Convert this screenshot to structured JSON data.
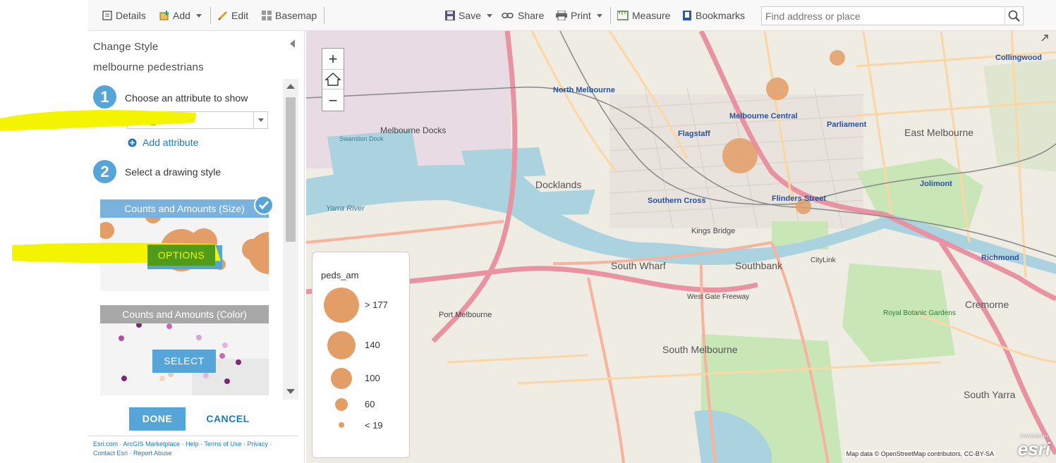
{
  "toolbar": {
    "details": "Details",
    "add": "Add",
    "edit": "Edit",
    "basemap": "Basemap",
    "save": "Save",
    "share": "Share",
    "print": "Print",
    "measure": "Measure",
    "bookmarks": "Bookmarks",
    "search_placeholder": "Find address or place"
  },
  "panel": {
    "title": "Change Style",
    "layer_name": "melbourne pedestrians",
    "step1_label": "Choose an attribute to show",
    "attribute_value": "peds_am",
    "add_attribute": "Add attribute",
    "step2_label": "Select a drawing style",
    "style_size_title": "Counts and Amounts (Size)",
    "options_button": "OPTIONS",
    "style_color_title": "Counts and Amounts (Color)",
    "select_button": "SELECT",
    "done_button": "DONE",
    "cancel_button": "CANCEL",
    "footer": {
      "esri": "Esri.com",
      "marketplace": "ArcGIS Marketplace",
      "help": "Help",
      "terms": "Terms of Use",
      "privacy": "Privacy",
      "contact": "Contact Esri",
      "report": "Report Abuse"
    }
  },
  "legend": {
    "title": "peds_am",
    "items": [
      {
        "label": "> 177"
      },
      {
        "label": "140"
      },
      {
        "label": "100"
      },
      {
        "label": "60"
      },
      {
        "label": "< 19"
      }
    ]
  },
  "map": {
    "attribution": "Map data © OpenStreetMap contributors, CC-BY-SA",
    "logo_small": "POWERED BY",
    "logo": "esri",
    "labels": {
      "docklands": "Docklands",
      "melbourne_docks": "Melbourne Docks",
      "north_melbourne": "North Melbourne",
      "melbourne_central": "Melbourne Central",
      "flagstaff": "Flagstaff",
      "parliament": "Parliament",
      "east_melbourne": "East Melbourne",
      "southbank": "Southbank",
      "south_wharf": "South Wharf",
      "south_melbourne": "South Melbourne",
      "port_melbourne": "Port Melbourne",
      "cremorne": "Cremorne",
      "south_yarra": "South Yarra",
      "jolimont": "Jolimont",
      "richmond": "Richmond",
      "collingwood": "Collingwood",
      "southern_cross": "Southern Cross",
      "flinders_street": "Flinders Street",
      "kings_bridge": "Kings Bridge",
      "swanston_dock": "Swanston Dock",
      "yarra_river": "Yarra River",
      "royal_botanic": "Royal Botanic Gardens",
      "west_gate_freeway": "West Gate Freeway",
      "citylink": "CityLink"
    }
  },
  "colors": {
    "accent": "#56a5d8",
    "highlight": "#f4f400",
    "symbol": "#e39d66",
    "water": "#aad3df",
    "park": "#c8e6b6",
    "motorway": "#e892a2"
  },
  "icons": [
    "details-icon",
    "add-icon",
    "edit-icon",
    "basemap-icon",
    "save-icon",
    "share-icon",
    "print-icon",
    "measure-icon",
    "bookmarks-icon",
    "search-icon",
    "zoom-in-icon",
    "home-icon",
    "zoom-out-icon",
    "check-icon",
    "plus-circle-icon",
    "collapse-arrow-icon",
    "expand-icon"
  ]
}
